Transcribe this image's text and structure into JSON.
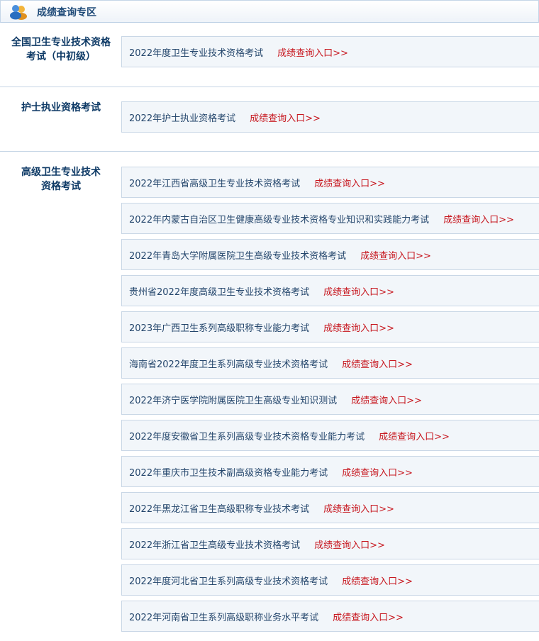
{
  "header": {
    "title": "成绩查询专区",
    "icon": "user-group-icon"
  },
  "link_label": "成绩查询入口>>",
  "colors": {
    "link": "#c7161e",
    "text": "#24466c",
    "label": "#0e3a66",
    "border": "#c9d7e6",
    "bg": "#f2f6fa"
  },
  "sections": [
    {
      "label_lines": [
        "全国卫生专业技术资格",
        "考试（中初级）"
      ],
      "items": [
        "2022年度卫生专业技术资格考试"
      ]
    },
    {
      "label_lines": [
        "护士执业资格考试"
      ],
      "items": [
        "2022年护士执业资格考试"
      ]
    },
    {
      "label_lines": [
        "高级卫生专业技术",
        "资格考试"
      ],
      "items": [
        "2022年江西省高级卫生专业技术资格考试",
        "2022年内蒙古自治区卫生健康高级专业技术资格专业知识和实践能力考试",
        "2022年青岛大学附属医院卫生高级专业技术资格考试",
        "贵州省2022年度高级卫生专业技术资格考试",
        "2023年广西卫生系列高级职称专业能力考试",
        "海南省2022年度卫生系列高级专业技术资格考试",
        "2022年济宁医学院附属医院卫生高级专业知识测试",
        "2022年度安徽省卫生系列高级专业技术资格专业能力考试",
        "2022年重庆市卫生技术副高级资格专业能力考试",
        "2022年黑龙江省卫生高级职称专业技术考试",
        "2022年浙江省卫生高级专业技术资格考试",
        "2022年度河北省卫生系列高级专业技术资格考试",
        "2022年河南省卫生系列高级职称业务水平考试"
      ]
    }
  ]
}
